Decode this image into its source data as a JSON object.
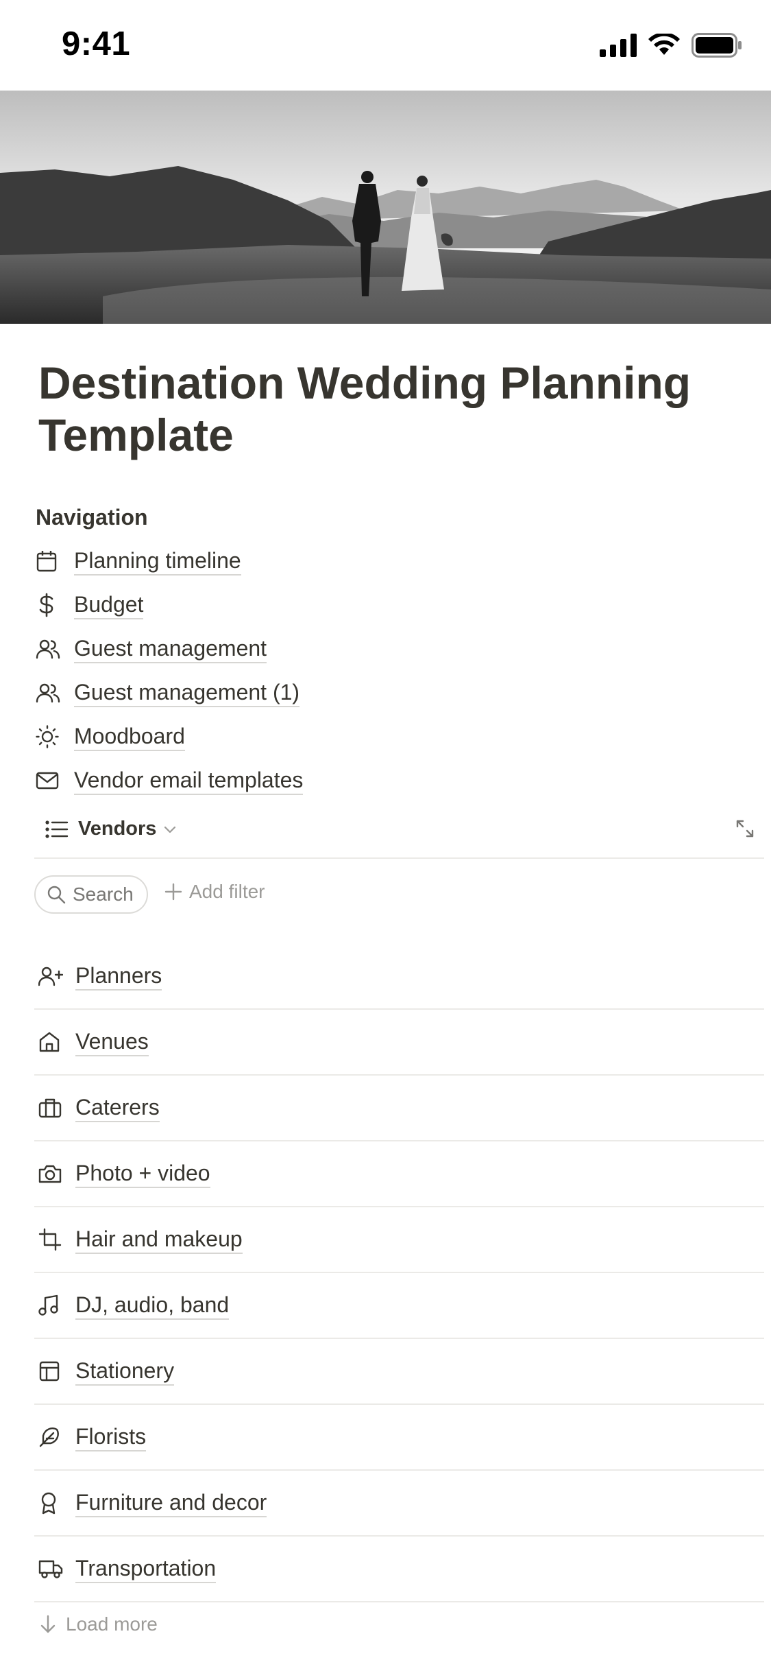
{
  "status_bar": {
    "time": "9:41"
  },
  "page": {
    "title": "Destination Wedding Planning Template"
  },
  "navigation": {
    "heading": "Navigation",
    "items": [
      {
        "label": "Planning timeline",
        "icon": "calendar-icon"
      },
      {
        "label": "Budget",
        "icon": "dollar-icon"
      },
      {
        "label": "Guest management",
        "icon": "people-icon"
      },
      {
        "label": "Guest management (1)",
        "icon": "people-icon"
      },
      {
        "label": "Moodboard",
        "icon": "sun-icon"
      },
      {
        "label": "Vendor email templates",
        "icon": "mail-icon"
      }
    ]
  },
  "view": {
    "name": "Vendors",
    "search_label": "Search",
    "add_filter_label": "Add filter"
  },
  "vendors": [
    {
      "label": "Planners",
      "icon": "user-plus-icon"
    },
    {
      "label": "Venues",
      "icon": "home-icon"
    },
    {
      "label": "Caterers",
      "icon": "briefcase-icon"
    },
    {
      "label": "Photo + video",
      "icon": "camera-icon"
    },
    {
      "label": "Hair and makeup",
      "icon": "crop-icon"
    },
    {
      "label": "DJ, audio, band",
      "icon": "music-icon"
    },
    {
      "label": "Stationery",
      "icon": "layout-icon"
    },
    {
      "label": "Florists",
      "icon": "feather-icon"
    },
    {
      "label": "Furniture and decor",
      "icon": "award-icon"
    },
    {
      "label": "Transportation",
      "icon": "truck-icon"
    }
  ],
  "load_more_label": "Load more",
  "colors": {
    "text": "#37352f",
    "muted": "#9b9a97",
    "divider": "#ebeae7"
  }
}
